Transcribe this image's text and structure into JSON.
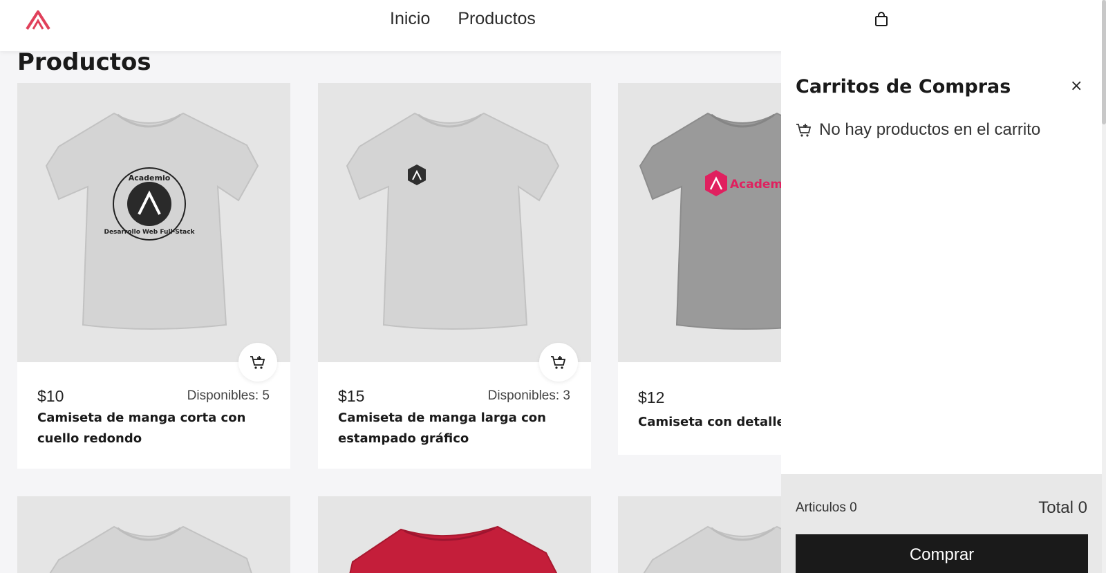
{
  "nav": {
    "items": [
      "Inicio",
      "Productos"
    ]
  },
  "page_title": "Productos",
  "products": [
    {
      "price": "$10",
      "stock": "Disponibles: 5",
      "name": "Camiseta de manga corta con cuello redondo"
    },
    {
      "price": "$15",
      "stock": "Disponibles: 3",
      "name": "Camiseta de manga larga con estampado gráfico"
    },
    {
      "price": "$12",
      "stock": "",
      "name": "Camiseta con detalle"
    }
  ],
  "prints": {
    "badge_top": "Academio",
    "badge_bottom": "Desarrollo Web Full-Stack",
    "brand": "Academ"
  },
  "cart": {
    "title": "Carritos de Compras",
    "close_label": "×",
    "empty_message": "No hay productos en el carrito",
    "articles_label": "Articulos 0",
    "total_label": "Total 0",
    "buy_label": "Comprar"
  },
  "colors": {
    "brand": "#e0405a",
    "button_dark": "#1a1a1a",
    "tee_red": "#c41e3a"
  },
  "icons": [
    "logo-icon",
    "shopping-bag-icon",
    "add-to-cart-icon",
    "cart-icon",
    "close-icon"
  ]
}
